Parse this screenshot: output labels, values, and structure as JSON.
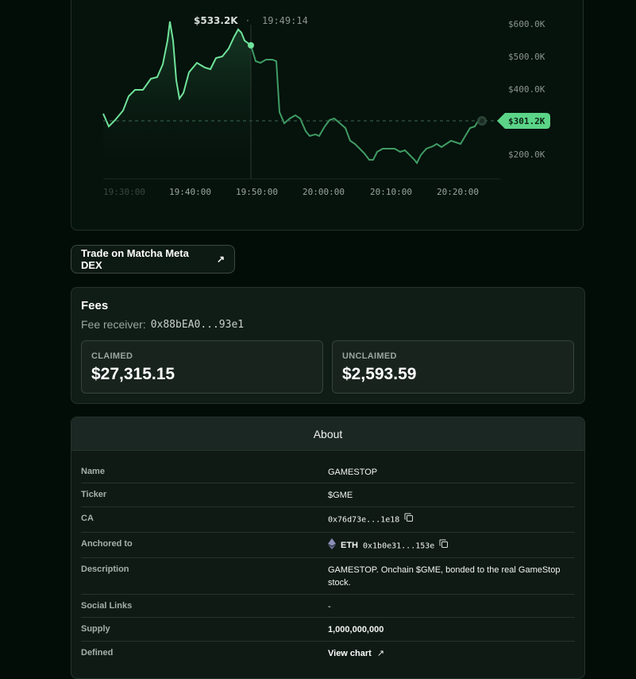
{
  "chart": {
    "hover_price": "$533.2K",
    "hover_sep": "·",
    "hover_time": "19:49:14",
    "current_price": "$301.2K",
    "y_ticks": [
      "$600.0K",
      "$500.0K",
      "$400.0K",
      "$200.0K"
    ],
    "x_ticks": [
      "19:30:00",
      "19:40:00",
      "19:50:00",
      "20:00:00",
      "20:10:00",
      "20:20:00"
    ],
    "line_color": "#56c97f"
  },
  "trade": {
    "label": "Trade on Matcha Meta DEX",
    "icon": "external-arrow-icon"
  },
  "fees": {
    "title": "Fees",
    "receiver_label": "Fee receiver:",
    "receiver_addr": "0x88bEA0...93e1",
    "claimed_label": "CLAIMED",
    "claimed_value": "$27,315.15",
    "unclaimed_label": "UNCLAIMED",
    "unclaimed_value": "$2,593.59"
  },
  "about": {
    "title": "About",
    "rows": {
      "name": {
        "k": "Name",
        "v": "GAMESTOP"
      },
      "ticker": {
        "k": "Ticker",
        "v": "$GME"
      },
      "ca": {
        "k": "CA",
        "v": "0x76d73e...1e18"
      },
      "anchored": {
        "k": "Anchored to",
        "chain": "ETH",
        "v": "0x1b0e31...153e"
      },
      "description": {
        "k": "Description",
        "v": "GAMESTOP. Onchain $GME, bonded to the real GameStop stock."
      },
      "social": {
        "k": "Social Links",
        "v": "-"
      },
      "supply": {
        "k": "Supply",
        "v": "1,000,000,000"
      },
      "defined": {
        "k": "Defined",
        "v": "View chart"
      }
    }
  }
}
